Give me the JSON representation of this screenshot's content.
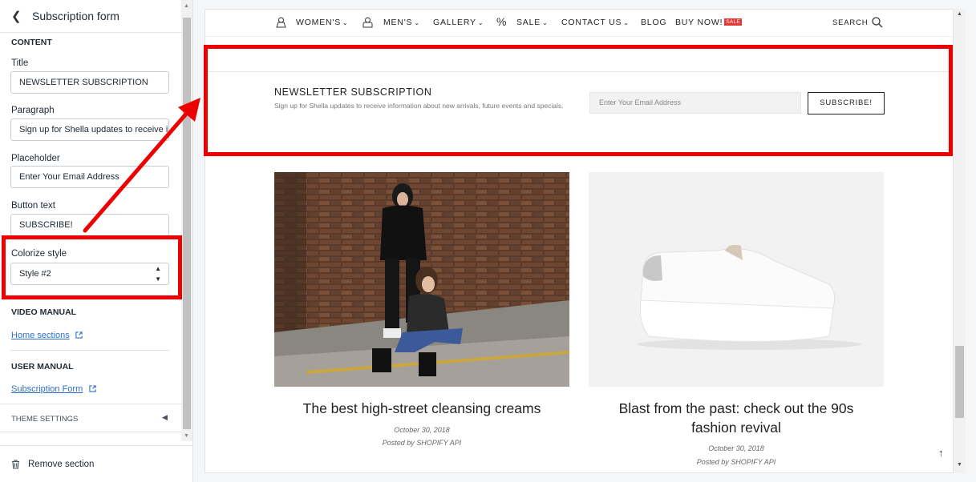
{
  "editor": {
    "title": "Subscription form",
    "content_heading": "CONTENT",
    "fields": {
      "title_label": "Title",
      "title_value": "NEWSLETTER SUBSCRIPTION",
      "paragraph_label": "Paragraph",
      "paragraph_value": "Sign up for Shella updates to receive information about new arrivals, future events and specials.",
      "placeholder_label": "Placeholder",
      "placeholder_value": "Enter Your Email Address",
      "button_text_label": "Button text",
      "button_text_value": "SUBSCRIBE!",
      "colorize_label": "Colorize style",
      "colorize_value": "Style #2"
    },
    "video_manual_heading": "VIDEO MANUAL",
    "video_manual_link": "Home sections",
    "user_manual_heading": "USER MANUAL",
    "user_manual_link": "Subscription Form",
    "theme_settings": "THEME SETTINGS",
    "remove_section": "Remove section"
  },
  "nav": {
    "items": [
      "WOMEN'S",
      "MEN'S",
      "GALLERY",
      "SALE",
      "CONTACT US",
      "BLOG",
      "BUY NOW!"
    ],
    "sale_badge": "SALE",
    "search": "SEARCH"
  },
  "newsletter": {
    "title": "NEWSLETTER SUBSCRIPTION",
    "text": "Sign up for Shella updates to receive information about new arrivals, future events and specials.",
    "placeholder": "Enter Your Email Address",
    "button": "SUBSCRIBE!"
  },
  "posts": [
    {
      "title": "The best high-street cleansing creams",
      "date": "October 30, 2018",
      "author": "Posted by SHOPIFY API"
    },
    {
      "title": "Blast from the past: check out the 90s fashion revival",
      "date": "October 30, 2018",
      "author": "Posted by SHOPIFY API"
    }
  ],
  "colors": {
    "highlight": "#ee0000",
    "link": "#2c6ecb",
    "sale": "#e53935"
  }
}
